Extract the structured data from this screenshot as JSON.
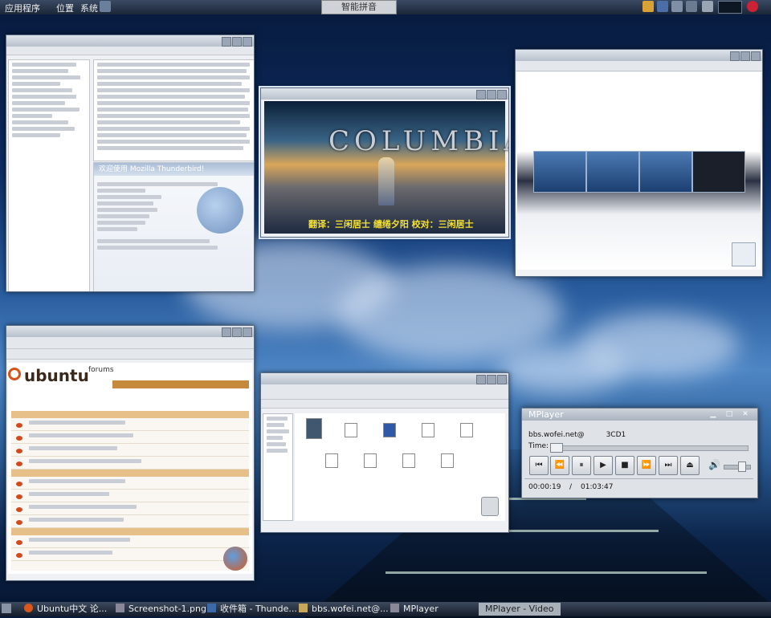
{
  "top_panel": {
    "menu_apps": "应用程序",
    "menu_places": "位置",
    "menu_system": "系统",
    "input_method": "智能拼音"
  },
  "thunderbird": {
    "welcome_header": "欢迎使用 Mozilla Thunderbird!"
  },
  "mplayer_video": {
    "title": "MPlayer - Video",
    "brand": "COLUMBIA",
    "subtitle": "翻译：三闲居士 缱绻夕阳 校对：三闲居士"
  },
  "ubuntu_forum": {
    "logo": "ubuntu",
    "forums_label": "forums"
  },
  "mplayer_control": {
    "title": "MPlayer",
    "stream": "bbs.wofei.net@",
    "disc": "3CD1",
    "time_label": "Time:",
    "elapsed": "00:00:19",
    "separator": "/",
    "total": "01:03:47",
    "progress_fraction": 0.005,
    "volume_fraction": 0.7
  },
  "taskbar": {
    "items": [
      {
        "label": "Ubuntu中文 论..."
      },
      {
        "label": "Screenshot-1.png"
      },
      {
        "label": "收件箱 - Thunde..."
      },
      {
        "label": "bbs.wofei.net@..."
      },
      {
        "label": "MPlayer"
      },
      {
        "label": "MPlayer - Video"
      }
    ]
  },
  "colors": {
    "accent": "#c58a3c",
    "panel": "#1b2638",
    "subtitle_yellow": "#f4e030"
  }
}
